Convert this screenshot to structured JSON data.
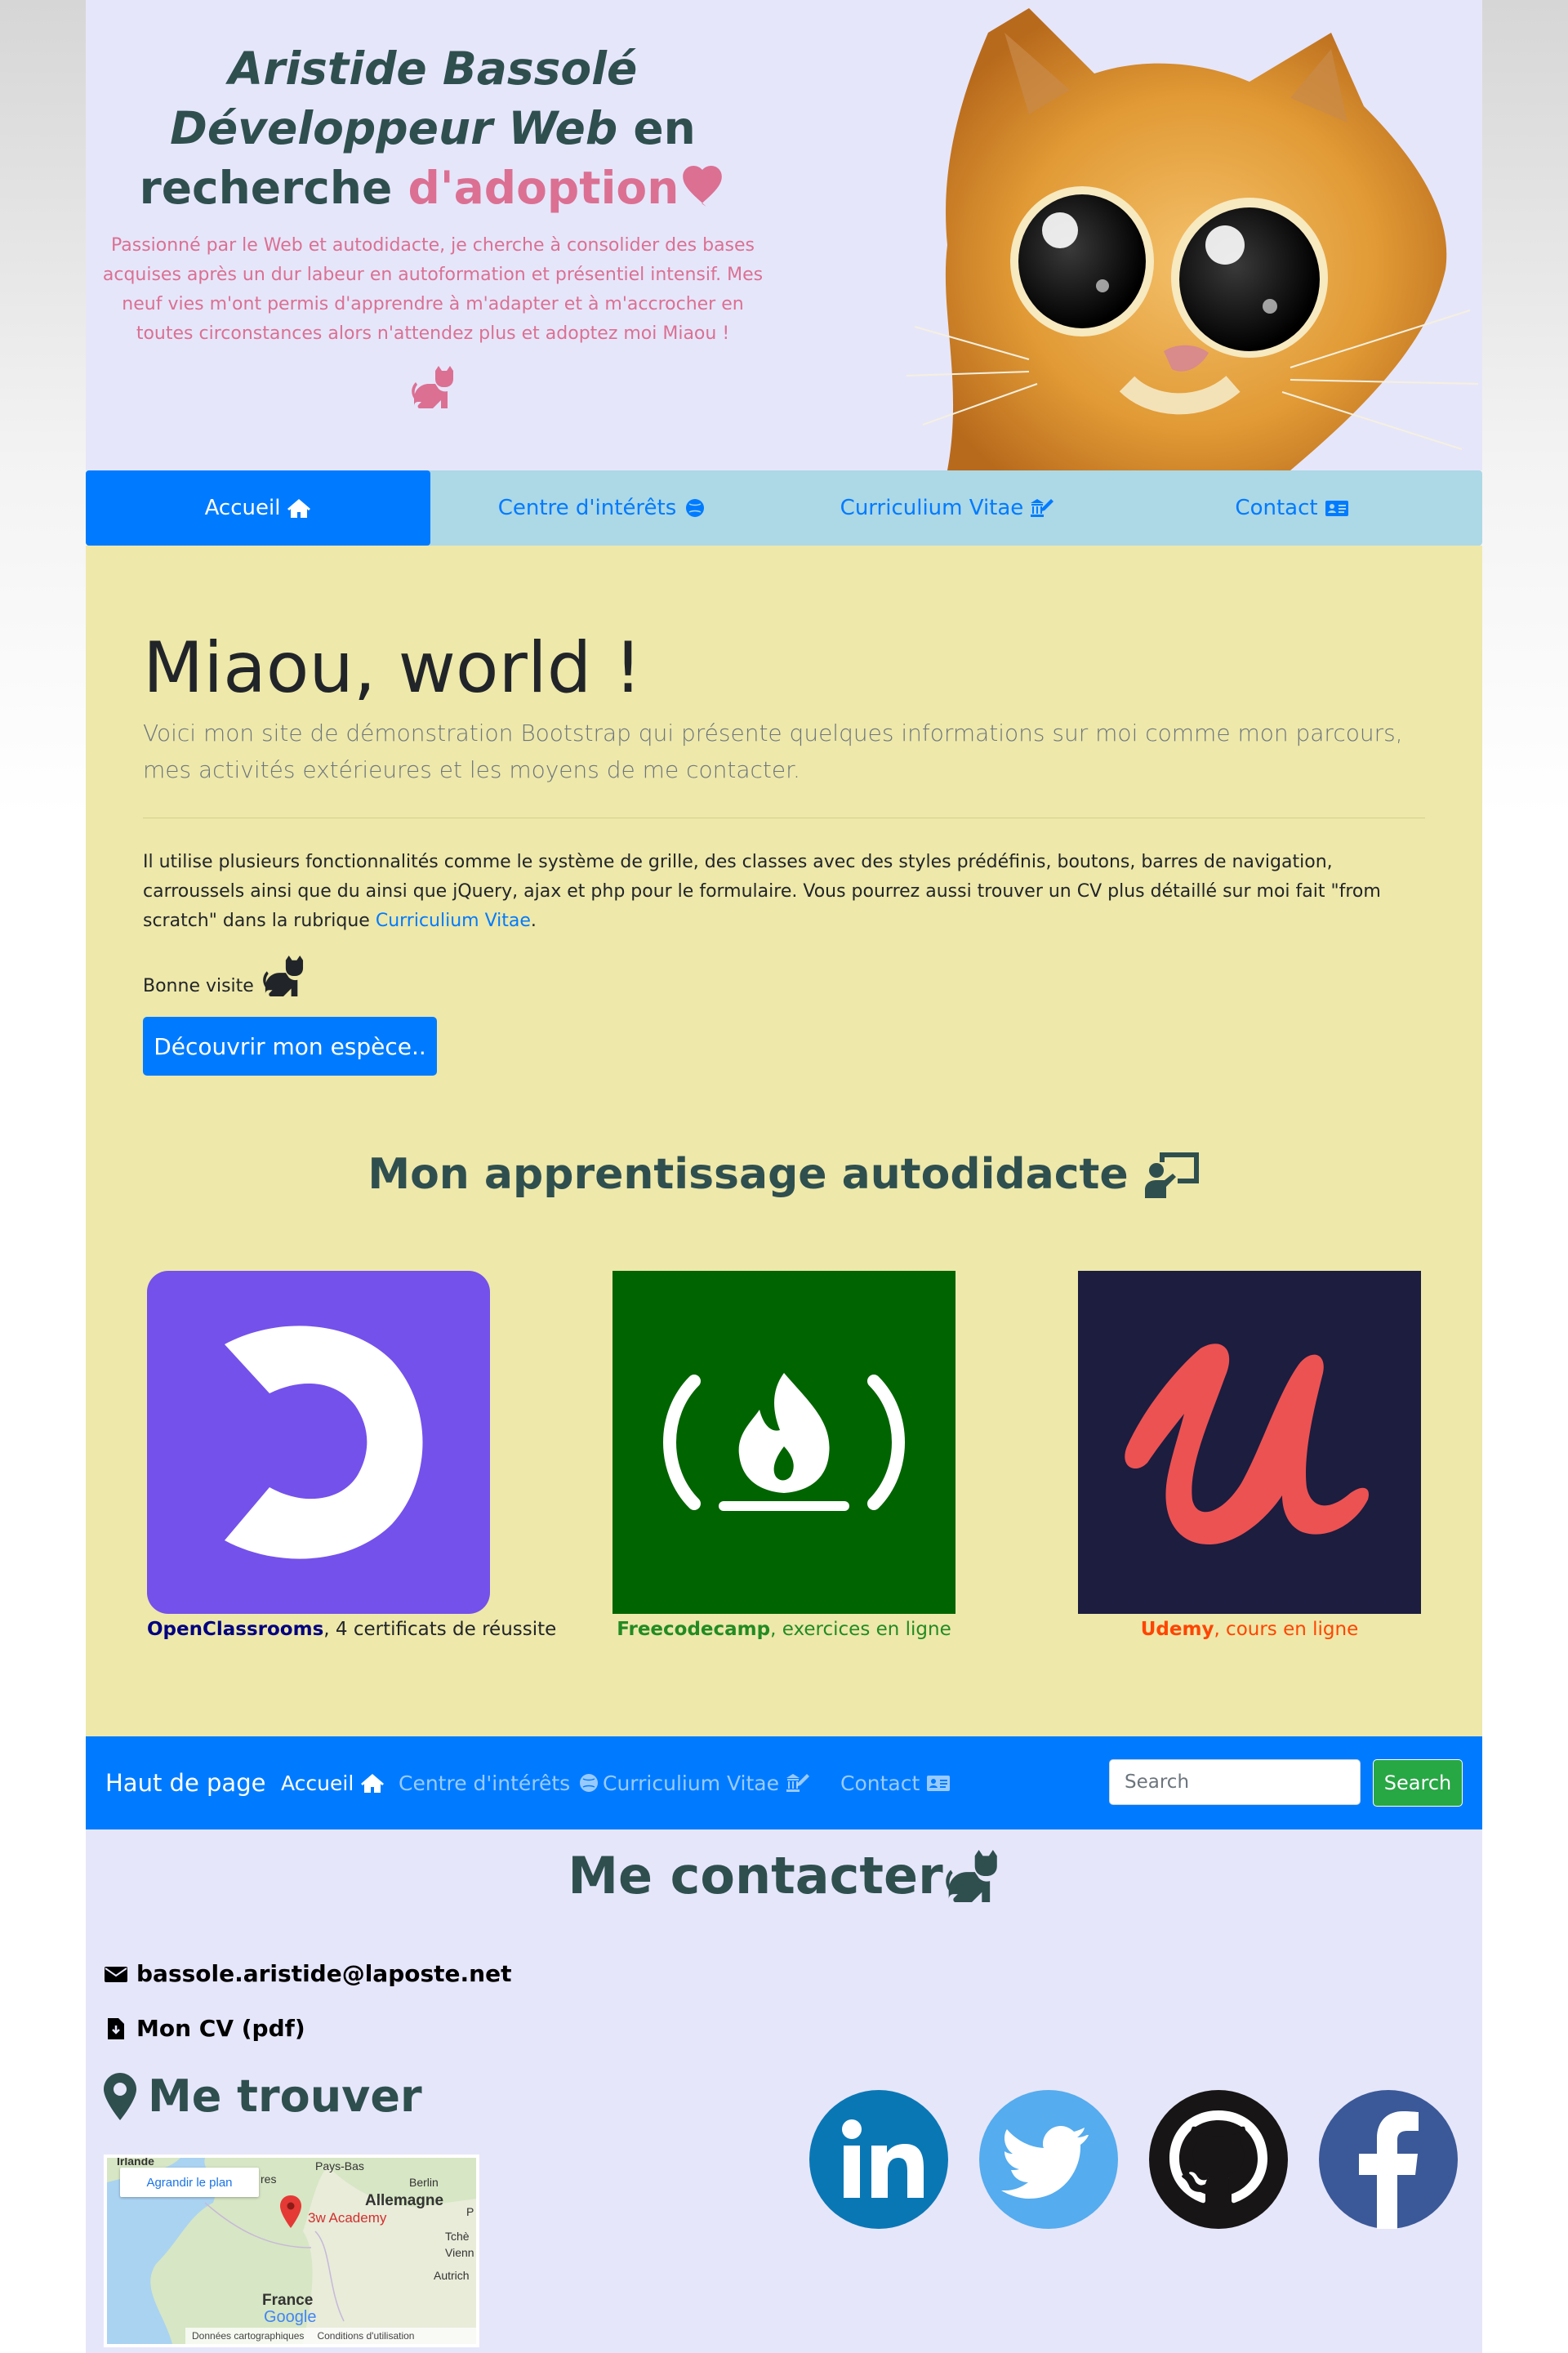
{
  "hero": {
    "line1": "Aristide Bassolé",
    "line2_italic": "Développeur Web",
    "line2_rest": " en",
    "line3_start": "recherche ",
    "line3_pink": "d'adoption",
    "description": "Passionné par le Web et autodidacte, je cherche à consolider des bases acquises après un dur labeur en autoformation et présentiel intensif. Mes neuf vies m'ont permis d'apprendre à m'adapter et à m'accrocher en toutes circonstances alors n'attendez plus et adoptez moi Miaou !",
    "heart_icon": "heart-icon",
    "cat_icon": "cat-icon"
  },
  "tabs": [
    {
      "label": "Accueil",
      "icon": "home-icon",
      "active": true
    },
    {
      "label": "Centre d'intérêts",
      "icon": "ball-icon",
      "active": false
    },
    {
      "label": "Curriculium Vitae",
      "icon": "landmark-pen-icon",
      "active": false
    },
    {
      "label": "Contact",
      "icon": "id-card-icon",
      "active": false
    }
  ],
  "main": {
    "title": "Miaou, world !",
    "lead": "Voici mon site de démonstration Bootstrap qui présente quelques informations sur moi comme mon parcours, mes activités extérieures et les moyens de me contacter.",
    "body_text": "Il utilise plusieurs fonctionnalités comme le système de grille, des classes avec des styles prédéfinis, boutons, barres de navigation, carroussels ainsi que du ainsi que jQuery, ajax et php pour le formulaire. Vous pourrez aussi trouver un CV plus détaillé sur moi fait \"from scratch\" dans la rubrique ",
    "body_link": "Curriculium Vitae",
    "body_end": ".",
    "bonne_visite": "Bonne visite",
    "button_label": "Découvrir mon espèce..",
    "section_title": "Mon apprentissage autodidacte",
    "cards": [
      {
        "name": "OpenClassrooms",
        "rest": ", 4 certificats de réussite",
        "color": "#000080",
        "bg": "#7451eb"
      },
      {
        "name": "Freecodecamp",
        "rest": ", exercices en ligne",
        "color": "#228b22",
        "bg": "#006400"
      },
      {
        "name": "Udemy",
        "rest": ", cours en ligne",
        "color": "#ff4500",
        "bg": "#1c1d3f"
      }
    ]
  },
  "navbar": {
    "brand": "Haut de page",
    "links": [
      {
        "label": "Accueil",
        "icon": "home-icon",
        "active": true
      },
      {
        "label": "Centre d'intérêts",
        "icon": "ball-icon",
        "active": false
      },
      {
        "label": "Curriculium Vitae",
        "icon": "landmark-pen-icon",
        "active": false
      },
      {
        "label": "Contact",
        "icon": "id-card-icon",
        "active": false
      }
    ],
    "search_placeholder": "Search",
    "search_button": "Search"
  },
  "contact": {
    "title": "Me contacter",
    "email": "bassole.aristide@laposte.net",
    "cv": "Mon CV (pdf)",
    "find_title": "Me trouver",
    "map": {
      "enlarge": "Agrandir le plan",
      "marker_label": "3w Academy",
      "labels": [
        "Irlande",
        "Pays-Bas",
        "Berlin",
        "Allemagne",
        "Tchè",
        "Vienn",
        "Autrich",
        "France",
        "res",
        "P"
      ],
      "footer_data": "Données cartographiques",
      "footer_terms": "Conditions d'utilisation",
      "google": "Google"
    },
    "social": [
      "linkedin-icon",
      "twitter-icon",
      "github-icon",
      "facebook-icon"
    ]
  },
  "colors": {
    "lavender": "#e6e6fa",
    "khaki": "#eee8aa",
    "primary": "#007bff",
    "tab_bar": "#add8e6",
    "slate": "#2f4f4f",
    "pink": "#db7093",
    "success": "#28a745"
  }
}
